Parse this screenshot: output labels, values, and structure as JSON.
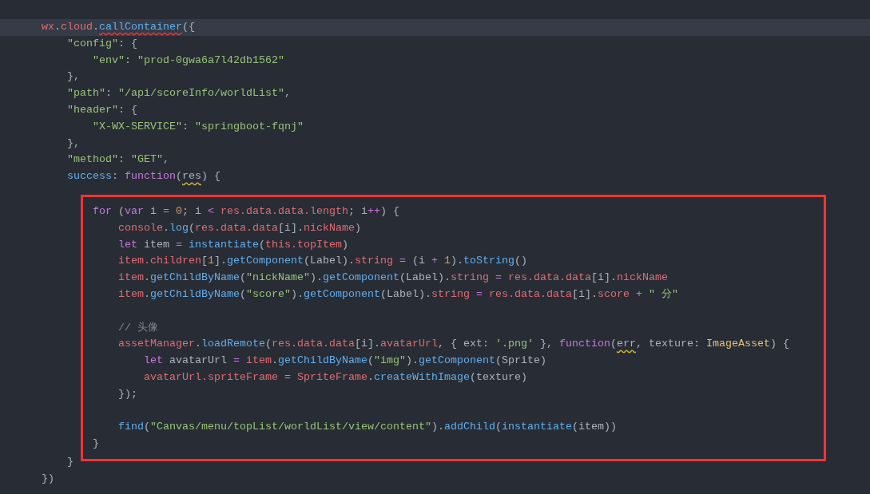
{
  "editor": {
    "lines": [
      {
        "kind": "line",
        "current": true,
        "tokens": [
          {
            "kind": "var",
            "text": "wx"
          },
          {
            "kind": "plain",
            "text": "."
          },
          {
            "kind": "var",
            "text": "cloud"
          },
          {
            "kind": "plain",
            "text": "."
          },
          {
            "kind": "error",
            "text": "callContainer"
          },
          {
            "kind": "plain",
            "text": "({"
          }
        ],
        "children": [
          {
            "kind": "line",
            "current": false,
            "tokens": [
              {
                "kind": "string",
                "text": "\"config\""
              },
              {
                "kind": "plain",
                "text": ": {"
              }
            ],
            "children": [
              {
                "kind": "line",
                "current": false,
                "tokens": [
                  {
                    "kind": "string",
                    "text": "\"env\""
                  },
                  {
                    "kind": "plain",
                    "text": ": "
                  },
                  {
                    "kind": "string",
                    "text": "\"prod-0gwa6a7l42db1562\""
                  }
                ]
              }
            ]
          },
          {
            "kind": "line",
            "current": false,
            "tokens": [
              {
                "kind": "plain",
                "text": "},"
              }
            ]
          },
          {
            "kind": "line",
            "current": false,
            "tokens": [
              {
                "kind": "string",
                "text": "\"path\""
              },
              {
                "kind": "plain",
                "text": ": "
              },
              {
                "kind": "string",
                "text": "\"/api/scoreInfo/worldList\""
              },
              {
                "kind": "plain",
                "text": ","
              }
            ]
          },
          {
            "kind": "line",
            "current": false,
            "tokens": [
              {
                "kind": "string",
                "text": "\"header\""
              },
              {
                "kind": "plain",
                "text": ": {"
              }
            ],
            "children": [
              {
                "kind": "line",
                "current": false,
                "tokens": [
                  {
                    "kind": "string",
                    "text": "\"X-WX-SERVICE\""
                  },
                  {
                    "kind": "plain",
                    "text": ": "
                  },
                  {
                    "kind": "string",
                    "text": "\"springboot-fqnj\""
                  }
                ]
              }
            ]
          },
          {
            "kind": "line",
            "current": false,
            "tokens": [
              {
                "kind": "plain",
                "text": "},"
              }
            ]
          },
          {
            "kind": "line",
            "current": false,
            "tokens": [
              {
                "kind": "string",
                "text": "\"method\""
              },
              {
                "kind": "plain",
                "text": ": "
              },
              {
                "kind": "string",
                "text": "\"GET\""
              },
              {
                "kind": "plain",
                "text": ","
              }
            ]
          },
          {
            "kind": "line",
            "current": false,
            "tokens": [
              {
                "kind": "func",
                "text": "success"
              },
              {
                "kind": "plain",
                "text": ": "
              },
              {
                "kind": "keyword",
                "text": "function"
              },
              {
                "kind": "plain",
                "text": "("
              },
              {
                "kind": "warning",
                "text": "res"
              },
              {
                "kind": "plain",
                "text": ") {"
              }
            ],
            "children": [
              {
                "kind": "box",
                "color": "#f03434",
                "lines": [
                  {
                    "kind": "line",
                    "current": false,
                    "tokens": [
                      {
                        "kind": "keyword",
                        "text": "for"
                      },
                      {
                        "kind": "plain",
                        "text": " ("
                      },
                      {
                        "kind": "keyword",
                        "text": "var"
                      },
                      {
                        "kind": "plain",
                        "text": " i "
                      },
                      {
                        "kind": "keyword",
                        "text": "= "
                      },
                      {
                        "kind": "number",
                        "text": "0"
                      },
                      {
                        "kind": "plain",
                        "text": "; i "
                      },
                      {
                        "kind": "keyword",
                        "text": "< "
                      },
                      {
                        "kind": "var",
                        "text": "res.data.data.length"
                      },
                      {
                        "kind": "plain",
                        "text": "; i"
                      },
                      {
                        "kind": "keyword",
                        "text": "++"
                      },
                      {
                        "kind": "plain",
                        "text": ") {"
                      }
                    ],
                    "children": [
                      {
                        "kind": "line",
                        "current": false,
                        "tokens": [
                          {
                            "kind": "var",
                            "text": "console"
                          },
                          {
                            "kind": "plain",
                            "text": "."
                          },
                          {
                            "kind": "func",
                            "text": "log"
                          },
                          {
                            "kind": "plain",
                            "text": "("
                          },
                          {
                            "kind": "var",
                            "text": "res.data.data"
                          },
                          {
                            "kind": "plain",
                            "text": "[i]."
                          },
                          {
                            "kind": "var",
                            "text": "nickName"
                          },
                          {
                            "kind": "plain",
                            "text": ")"
                          }
                        ]
                      },
                      {
                        "kind": "line",
                        "current": false,
                        "tokens": [
                          {
                            "kind": "keyword",
                            "text": "let"
                          },
                          {
                            "kind": "plain",
                            "text": " item "
                          },
                          {
                            "kind": "keyword",
                            "text": "= "
                          },
                          {
                            "kind": "func",
                            "text": "instantiate"
                          },
                          {
                            "kind": "plain",
                            "text": "("
                          },
                          {
                            "kind": "var",
                            "text": "this.topItem"
                          },
                          {
                            "kind": "plain",
                            "text": ")"
                          }
                        ]
                      },
                      {
                        "kind": "line",
                        "current": false,
                        "tokens": [
                          {
                            "kind": "var",
                            "text": "item.children"
                          },
                          {
                            "kind": "plain",
                            "text": "["
                          },
                          {
                            "kind": "number",
                            "text": "1"
                          },
                          {
                            "kind": "plain",
                            "text": "]."
                          },
                          {
                            "kind": "func",
                            "text": "getComponent"
                          },
                          {
                            "kind": "plain",
                            "text": "(Label)."
                          },
                          {
                            "kind": "var",
                            "text": "string "
                          },
                          {
                            "kind": "keyword",
                            "text": "="
                          },
                          {
                            "kind": "plain",
                            "text": " (i "
                          },
                          {
                            "kind": "keyword",
                            "text": "+ "
                          },
                          {
                            "kind": "number",
                            "text": "1"
                          },
                          {
                            "kind": "plain",
                            "text": ")."
                          },
                          {
                            "kind": "func",
                            "text": "toString"
                          },
                          {
                            "kind": "plain",
                            "text": "()"
                          }
                        ]
                      },
                      {
                        "kind": "line",
                        "current": false,
                        "tokens": [
                          {
                            "kind": "var",
                            "text": "item"
                          },
                          {
                            "kind": "plain",
                            "text": "."
                          },
                          {
                            "kind": "func",
                            "text": "getChildByName"
                          },
                          {
                            "kind": "plain",
                            "text": "("
                          },
                          {
                            "kind": "string",
                            "text": "\"nickName\""
                          },
                          {
                            "kind": "plain",
                            "text": ")."
                          },
                          {
                            "kind": "func",
                            "text": "getComponent"
                          },
                          {
                            "kind": "plain",
                            "text": "(Label)."
                          },
                          {
                            "kind": "var",
                            "text": "string "
                          },
                          {
                            "kind": "keyword",
                            "text": "= "
                          },
                          {
                            "kind": "var",
                            "text": "res.data.data"
                          },
                          {
                            "kind": "plain",
                            "text": "[i]."
                          },
                          {
                            "kind": "var",
                            "text": "nickName"
                          }
                        ]
                      },
                      {
                        "kind": "line",
                        "current": false,
                        "tokens": [
                          {
                            "kind": "var",
                            "text": "item"
                          },
                          {
                            "kind": "plain",
                            "text": "."
                          },
                          {
                            "kind": "func",
                            "text": "getChildByName"
                          },
                          {
                            "kind": "plain",
                            "text": "("
                          },
                          {
                            "kind": "string",
                            "text": "\"score\""
                          },
                          {
                            "kind": "plain",
                            "text": ")."
                          },
                          {
                            "kind": "func",
                            "text": "getComponent"
                          },
                          {
                            "kind": "plain",
                            "text": "(Label)."
                          },
                          {
                            "kind": "var",
                            "text": "string "
                          },
                          {
                            "kind": "keyword",
                            "text": "= "
                          },
                          {
                            "kind": "var",
                            "text": "res.data.data"
                          },
                          {
                            "kind": "plain",
                            "text": "[i]."
                          },
                          {
                            "kind": "var",
                            "text": "score "
                          },
                          {
                            "kind": "keyword",
                            "text": "+ "
                          },
                          {
                            "kind": "string",
                            "text": "\" 分\""
                          }
                        ]
                      },
                      {
                        "kind": "blank",
                        "current": false
                      },
                      {
                        "kind": "line",
                        "current": false,
                        "tokens": [
                          {
                            "kind": "comment",
                            "text": "// 头像"
                          }
                        ]
                      },
                      {
                        "kind": "line",
                        "current": false,
                        "tokens": [
                          {
                            "kind": "var",
                            "text": "assetManager"
                          },
                          {
                            "kind": "plain",
                            "text": "."
                          },
                          {
                            "kind": "func",
                            "text": "loadRemote"
                          },
                          {
                            "kind": "plain",
                            "text": "("
                          },
                          {
                            "kind": "var",
                            "text": "res.data.data"
                          },
                          {
                            "kind": "plain",
                            "text": "[i]."
                          },
                          {
                            "kind": "var",
                            "text": "avatarUrl"
                          },
                          {
                            "kind": "plain",
                            "text": ", { ext: "
                          },
                          {
                            "kind": "string",
                            "text": "'.png'"
                          },
                          {
                            "kind": "plain",
                            "text": " }, "
                          },
                          {
                            "kind": "keyword",
                            "text": "function"
                          },
                          {
                            "kind": "plain",
                            "text": "("
                          },
                          {
                            "kind": "warning",
                            "text": "err"
                          },
                          {
                            "kind": "plain",
                            "text": ", texture: "
                          },
                          {
                            "kind": "type",
                            "text": "ImageAsset"
                          },
                          {
                            "kind": "plain",
                            "text": ") {"
                          }
                        ],
                        "children": [
                          {
                            "kind": "line",
                            "current": false,
                            "tokens": [
                              {
                                "kind": "keyword",
                                "text": "let"
                              },
                              {
                                "kind": "plain",
                                "text": " avatarUrl "
                              },
                              {
                                "kind": "keyword",
                                "text": "= "
                              },
                              {
                                "kind": "var",
                                "text": "item"
                              },
                              {
                                "kind": "plain",
                                "text": "."
                              },
                              {
                                "kind": "func",
                                "text": "getChildByName"
                              },
                              {
                                "kind": "plain",
                                "text": "("
                              },
                              {
                                "kind": "string",
                                "text": "\"img\""
                              },
                              {
                                "kind": "plain",
                                "text": ")."
                              },
                              {
                                "kind": "func",
                                "text": "getComponent"
                              },
                              {
                                "kind": "plain",
                                "text": "(Sprite)"
                              }
                            ]
                          },
                          {
                            "kind": "line",
                            "current": false,
                            "tokens": [
                              {
                                "kind": "var",
                                "text": "avatarUrl.spriteFrame "
                              },
                              {
                                "kind": "keyword",
                                "text": "= "
                              },
                              {
                                "kind": "var",
                                "text": "SpriteFrame"
                              },
                              {
                                "kind": "plain",
                                "text": "."
                              },
                              {
                                "kind": "func",
                                "text": "createWithImage"
                              },
                              {
                                "kind": "plain",
                                "text": "(texture)"
                              }
                            ]
                          }
                        ]
                      },
                      {
                        "kind": "line",
                        "current": false,
                        "tokens": [
                          {
                            "kind": "plain",
                            "text": "});"
                          }
                        ]
                      },
                      {
                        "kind": "blank",
                        "current": false
                      },
                      {
                        "kind": "line",
                        "current": false,
                        "tokens": [
                          {
                            "kind": "func",
                            "text": "find"
                          },
                          {
                            "kind": "plain",
                            "text": "("
                          },
                          {
                            "kind": "string",
                            "text": "\"Canvas/menu/topList/worldList/view/content\""
                          },
                          {
                            "kind": "plain",
                            "text": ")."
                          },
                          {
                            "kind": "func",
                            "text": "addChild"
                          },
                          {
                            "kind": "plain",
                            "text": "("
                          },
                          {
                            "kind": "func",
                            "text": "instantiate"
                          },
                          {
                            "kind": "plain",
                            "text": "(item))"
                          }
                        ]
                      }
                    ]
                  },
                  {
                    "kind": "line",
                    "current": false,
                    "tokens": [
                      {
                        "kind": "plain",
                        "text": "}"
                      }
                    ]
                  }
                ]
              }
            ]
          },
          {
            "kind": "line",
            "current": false,
            "tokens": [
              {
                "kind": "plain",
                "text": "}"
              }
            ]
          }
        ]
      },
      {
        "kind": "line",
        "current": false,
        "tokens": [
          {
            "kind": "plain",
            "text": "})"
          }
        ]
      }
    ]
  }
}
